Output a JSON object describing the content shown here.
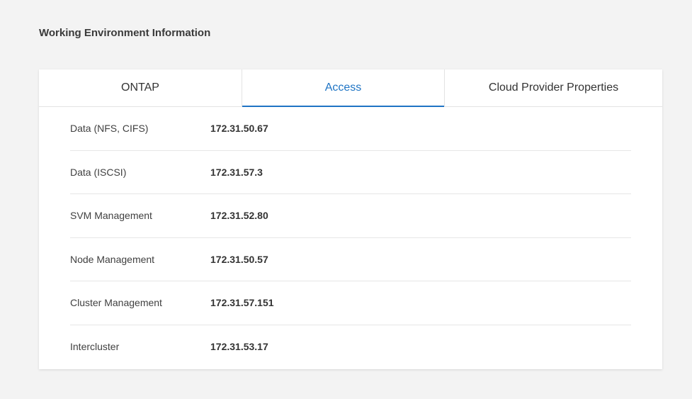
{
  "section": {
    "title": "Working Environment Information"
  },
  "tabs": [
    {
      "label": "ONTAP",
      "active": false
    },
    {
      "label": "Access",
      "active": true
    },
    {
      "label": "Cloud Provider Properties",
      "active": false
    }
  ],
  "access": {
    "rows": [
      {
        "label": "Data (NFS, CIFS)",
        "value": "172.31.50.67"
      },
      {
        "label": "Data (ISCSI)",
        "value": "172.31.57.3"
      },
      {
        "label": "SVM Management",
        "value": "172.31.52.80"
      },
      {
        "label": "Node Management",
        "value": "172.31.50.57"
      },
      {
        "label": "Cluster Management",
        "value": "172.31.57.151"
      },
      {
        "label": "Intercluster",
        "value": "172.31.53.17"
      }
    ]
  },
  "colors": {
    "accent": "#1f74c4",
    "background": "#f3f3f3",
    "card": "#ffffff"
  }
}
